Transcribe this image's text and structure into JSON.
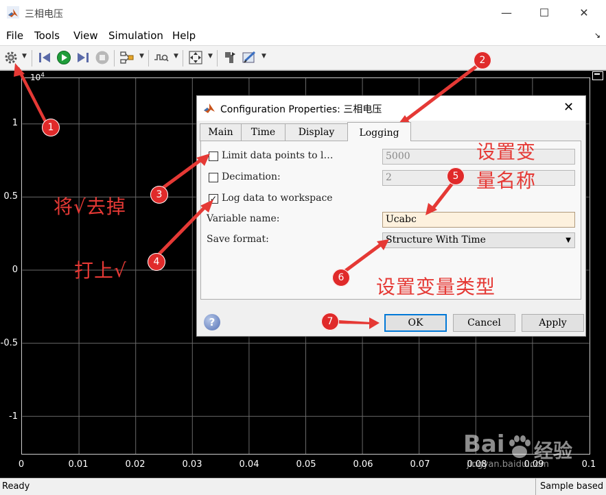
{
  "window": {
    "title": "三相电压",
    "min": "—",
    "max": "☐",
    "close": "✕"
  },
  "menu": {
    "items": [
      "File",
      "Tools",
      "View",
      "Simulation",
      "Help"
    ],
    "dock": "↘"
  },
  "toolbar": {
    "icons": [
      "gear-icon",
      "step-back-icon",
      "run-icon",
      "step-forward-icon",
      "stop-icon",
      "signal-select-icon",
      "triggers-icon",
      "zoom-fit-icon",
      "highlight-block-icon",
      "style-icon"
    ],
    "accent": "#1f9d3a"
  },
  "scope": {
    "exponent": {
      "base": "10",
      "exp": "4"
    },
    "yticks": [
      "1",
      "0.5",
      "0",
      "-0.5",
      "-1"
    ],
    "xticks": [
      "0",
      "0.01",
      "0.02",
      "0.03",
      "0.04",
      "0.05",
      "0.06",
      "0.07",
      "0.08",
      "0.09",
      "0.1"
    ],
    "background": "#000000",
    "grid": true
  },
  "status": {
    "left": "Ready",
    "right": "Sample based"
  },
  "dialog": {
    "title": "Configuration Properties: 三相电压",
    "tabs": [
      "Main",
      "Time",
      "Display",
      "Logging"
    ],
    "active_tab": "Logging",
    "limit_label": "Limit data points to l…",
    "limit_value": "5000",
    "limit_checked": false,
    "decimation_label": "Decimation:",
    "decimation_value": "2",
    "decimation_checked": false,
    "log_label": "Log data to workspace",
    "log_checked": true,
    "varname_label": "Variable name:",
    "varname_value": "Ucabc",
    "format_label": "Save format:",
    "format_value": "Structure With Time",
    "help": "?",
    "ok": "OK",
    "cancel": "Cancel",
    "apply": "Apply"
  },
  "annotations": {
    "texts": [
      "将√去掉",
      "打上√",
      "设置变",
      "量名称",
      "设置变量类型"
    ],
    "numbers": [
      "1",
      "2",
      "3",
      "4",
      "5",
      "6",
      "7"
    ],
    "color": "#e53935"
  },
  "watermark": {
    "brand": "Bai",
    "brand2": "经验",
    "url": "jingyan.baidu.com"
  }
}
